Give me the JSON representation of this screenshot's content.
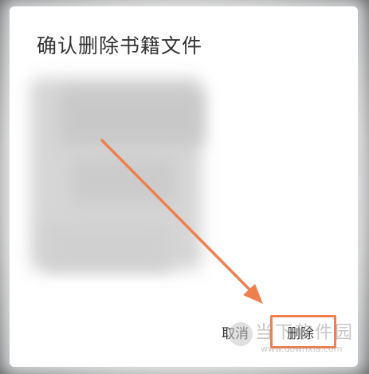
{
  "dialog": {
    "title": "确认删除书籍文件",
    "cancel_label": "取消",
    "delete_label": "删除"
  },
  "annotation": {
    "arrow_color": "#f07f4f",
    "highlight_color": "#f07f4f"
  },
  "watermark": {
    "text": "当下软件园",
    "url": "www.downxia.com"
  },
  "colors": {
    "title_text": "#333333",
    "dialog_bg": "#ffffff"
  }
}
